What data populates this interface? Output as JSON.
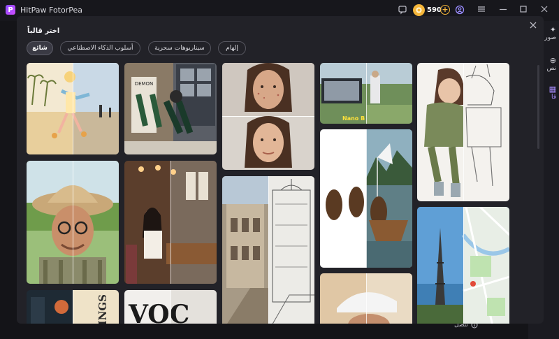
{
  "app": {
    "title": "HitPaw FotorPea",
    "logo_letter": "P",
    "coins": "590"
  },
  "sidebar": {
    "items": [
      "صور",
      "نص",
      "قا"
    ],
    "contact_label": "تتصل"
  },
  "modal": {
    "title": "اختر قالباً",
    "tabs": [
      {
        "label": "شائع",
        "active": true
      },
      {
        "label": "أسلوب الذكاء الاصطناعي",
        "active": false
      },
      {
        "label": "سيناريوهات سحرية",
        "active": false
      },
      {
        "label": "إلهام",
        "active": false
      }
    ]
  },
  "cards": {
    "nano_label": "Nano B",
    "card_texts": {
      "lings": "LINGS",
      "voc": "VOC"
    }
  },
  "colors": {
    "accent": "#8a5cff",
    "coin": "#f5b63a",
    "modal_bg": "#222228"
  }
}
